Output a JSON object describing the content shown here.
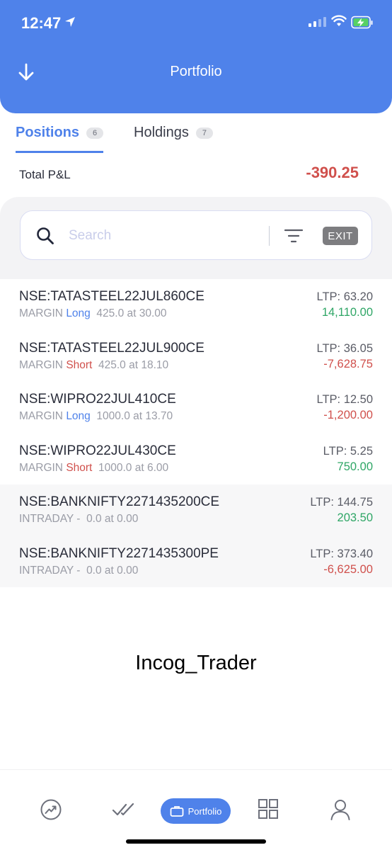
{
  "status_bar": {
    "time": "12:47"
  },
  "header": {
    "title": "Portfolio"
  },
  "tabs": [
    {
      "label": "Positions",
      "count": "6"
    },
    {
      "label": "Holdings",
      "count": "7"
    }
  ],
  "summary": {
    "label": "Total P&L",
    "value": "-390.25"
  },
  "search": {
    "placeholder": "Search",
    "exit_label": "EXIT"
  },
  "positions": [
    {
      "symbol": "NSE:TATASTEEL22JUL860CE",
      "product": "MARGIN",
      "side": "Long",
      "qty_price": "425.0 at 30.00",
      "ltp": "LTP: 63.20",
      "pnl": "14,110.00"
    },
    {
      "symbol": "NSE:TATASTEEL22JUL900CE",
      "product": "MARGIN",
      "side": "Short",
      "qty_price": "425.0 at 18.10",
      "ltp": "LTP: 36.05",
      "pnl": "-7,628.75"
    },
    {
      "symbol": "NSE:WIPRO22JUL410CE",
      "product": "MARGIN",
      "side": "Long",
      "qty_price": "1000.0 at 13.70",
      "ltp": "LTP: 12.50",
      "pnl": "-1,200.00"
    },
    {
      "symbol": "NSE:WIPRO22JUL430CE",
      "product": "MARGIN",
      "side": "Short",
      "qty_price": "1000.0 at 6.00",
      "ltp": "LTP: 5.25",
      "pnl": "750.00"
    },
    {
      "symbol": "NSE:BANKNIFTY2271435200CE",
      "product": "INTRADAY",
      "side": "-",
      "qty_price": "0.0 at 0.00",
      "ltp": "LTP: 144.75",
      "pnl": "203.50"
    },
    {
      "symbol": "NSE:BANKNIFTY2271435300PE",
      "product": "INTRADAY",
      "side": "-",
      "qty_price": "0.0 at 0.00",
      "ltp": "LTP: 373.40",
      "pnl": "-6,625.00"
    }
  ],
  "watermark": "Incog_Trader",
  "bottom_nav": {
    "items": [
      {
        "icon": "trending-icon"
      },
      {
        "icon": "double-check-icon"
      },
      {
        "icon": "briefcase-icon",
        "label": "Portfolio"
      },
      {
        "icon": "grid-icon"
      },
      {
        "icon": "user-icon"
      }
    ]
  },
  "colors": {
    "accent": "#4f82ea",
    "profit": "#2fa666",
    "loss": "#d0504c"
  }
}
